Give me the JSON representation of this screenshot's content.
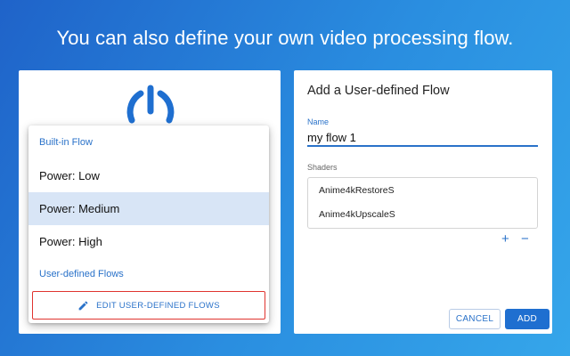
{
  "headline": "You can also define your own video processing flow.",
  "left_panel": {
    "power_icon": "power-icon",
    "menu": {
      "builtin_header": "Built-in Flow",
      "items": [
        "Power: Low",
        "Power: Medium",
        "Power: High"
      ],
      "selected_item": "Power: Medium",
      "user_header": "User-defined Flows",
      "edit_button": {
        "label": "EDIT USER-DEFINED FLOWS",
        "icon": "pencil-icon"
      }
    }
  },
  "dialog": {
    "title": "Add a User-defined Flow",
    "name_label": "Name",
    "name_value": "my flow 1",
    "shaders_label": "Shaders",
    "shaders": [
      "Anime4kRestoreS",
      "Anime4kUpscaleS"
    ],
    "add_shader": "+",
    "remove_shader": "−",
    "cancel_label": "CANCEL",
    "add_label": "ADD"
  },
  "colors": {
    "accent": "#2a72c9",
    "selected_bg": "#d8e5f6",
    "highlight_border": "#e0342f",
    "background_gradient": [
      "#1f63c9",
      "#35a6ea"
    ]
  }
}
